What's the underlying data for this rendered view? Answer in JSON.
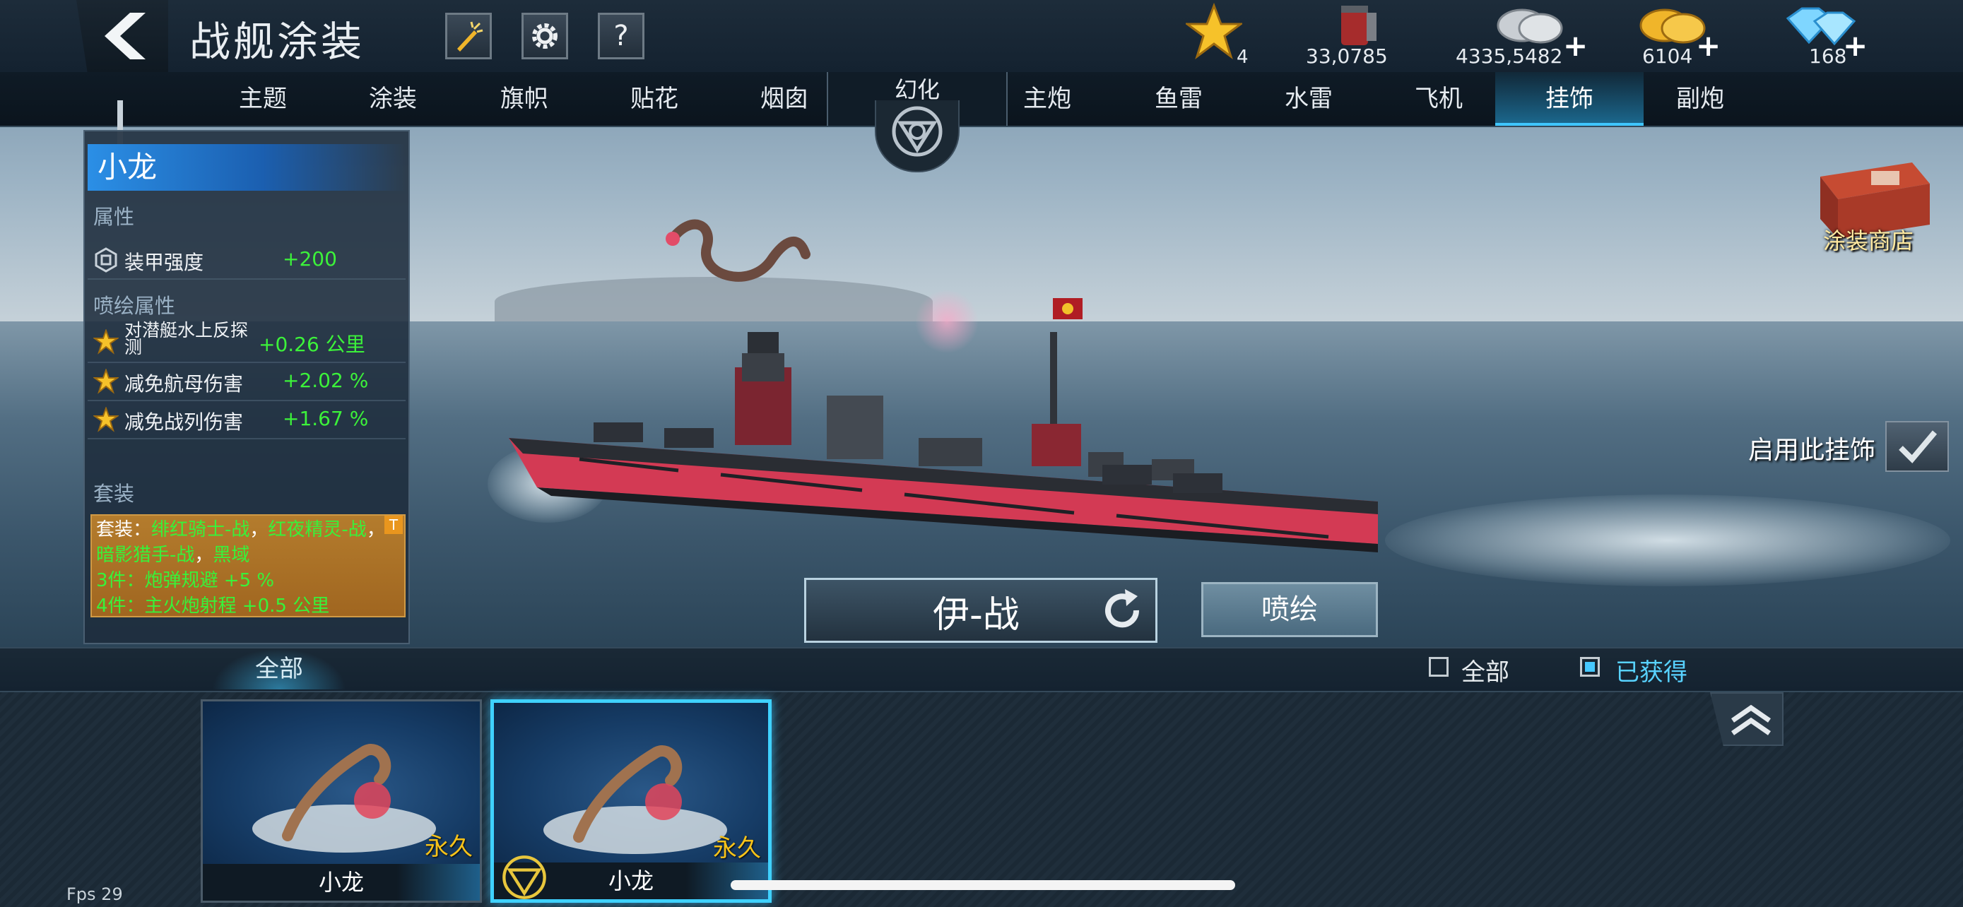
{
  "header": {
    "title": "战舰涂装",
    "help_label": "?",
    "resources": {
      "stars": "4",
      "paint": "33,0785",
      "silver": "4335,5482",
      "gold": "6104",
      "diamond": "168"
    }
  },
  "tabs": [
    {
      "label": "主题"
    },
    {
      "label": "涂装"
    },
    {
      "label": "旗帜"
    },
    {
      "label": "贴花"
    },
    {
      "label": "烟囱"
    },
    {
      "label": "主炮"
    },
    {
      "label": "鱼雷"
    },
    {
      "label": "水雷"
    },
    {
      "label": "飞机"
    },
    {
      "label": "挂饰"
    },
    {
      "label": "副炮"
    }
  ],
  "illusion_label": "幻化",
  "info": {
    "name": "小龙",
    "attr_title": "属性",
    "attrs": [
      {
        "key": "装甲强度",
        "value": "+200"
      }
    ],
    "spray_title": "喷绘属性",
    "spray_attrs": [
      {
        "key": "对潜艇水上反探\n测",
        "value": "+0.26 公里"
      },
      {
        "key": "减免航母伤害",
        "value": "+2.02 %"
      },
      {
        "key": "减免战列伤害",
        "value": "+1.67 %"
      }
    ],
    "suit_title": "套装",
    "suit": {
      "p1": "套装：",
      "p2": "绯红骑士-战",
      "p3": "，",
      "p4": "红夜精灵-战",
      "p5": "，",
      "p6": "暗影猎手-战",
      "p7": "，",
      "p8": "黑域",
      "line2": "3件：炮弹规避 +5 %",
      "line3": "4件：主火炮射程 +0.5 公里",
      "mark": "T"
    }
  },
  "shop_label": "涂装商店",
  "enable_label": "启用此挂饰",
  "ship_name": "伊-战",
  "paint_button": "喷绘",
  "filter": {
    "tab_all": "全部",
    "cb_all": "全部",
    "cb_owned": "已获得"
  },
  "items": [
    {
      "name": "小龙",
      "duration": "永久"
    },
    {
      "name": "小龙",
      "duration": "永久"
    }
  ],
  "fps": "Fps 29",
  "colors": {
    "accent": "#3fc6ff",
    "stat_green": "#3cf23a",
    "suit_bg": "#a86b22",
    "perm_gold": "#f6c21a"
  }
}
